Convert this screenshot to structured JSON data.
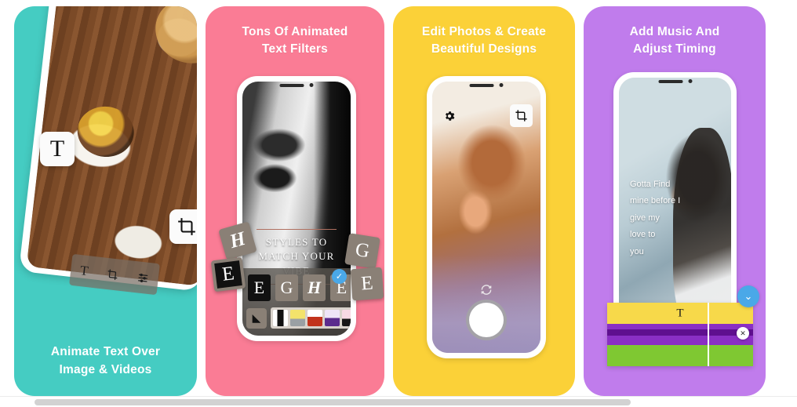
{
  "gallery": {
    "background": "#ffffff",
    "panels": [
      {
        "id": "animate-text",
        "accent": "#45ccc2",
        "title": "",
        "caption_line1": "Animate Text Over",
        "caption_line2": "Image & Videos",
        "photo_alt": "food-plates-on-wooden-table",
        "floating_icons": [
          {
            "name": "text-tool-icon",
            "glyph": "T"
          },
          {
            "name": "crop-tool-icon",
            "glyph": "crop"
          }
        ],
        "toolbar": {
          "items": [
            {
              "name": "text-tool",
              "glyph": "T"
            },
            {
              "name": "crop-tool",
              "glyph": "crop"
            },
            {
              "name": "adjust-sliders-tool",
              "glyph": "sliders"
            }
          ]
        }
      },
      {
        "id": "text-filters",
        "accent": "#fa7c95",
        "title_line1": "Tons Of Animated",
        "title_line2": "Text Filters",
        "caption_line1": "",
        "caption_line2": "",
        "screen_overlay": {
          "line1": "STYLES TO",
          "line2": "MATCH YOUR",
          "line3": "VIBE"
        },
        "floating_tiles": [
          {
            "name": "style-tile-h",
            "glyph": "H"
          },
          {
            "name": "style-tile-e-dark",
            "glyph": "E"
          },
          {
            "name": "style-tile-g",
            "glyph": "G"
          },
          {
            "name": "style-tile-e",
            "glyph": "E"
          }
        ],
        "style_row": [
          {
            "name": "style-option-e-dark",
            "glyph": "E",
            "selected": false
          },
          {
            "name": "style-option-g",
            "glyph": "G",
            "selected": false
          },
          {
            "name": "style-option-h",
            "glyph": "H",
            "selected": false
          },
          {
            "name": "style-option-e",
            "glyph": "E",
            "selected": true
          }
        ],
        "selected_badge": "✓",
        "ink_glyph": "◣",
        "filter_swatches": [
          "a",
          "b",
          "c",
          "d",
          "e"
        ]
      },
      {
        "id": "edit-photos",
        "accent": "#fbd138",
        "title_line1": "Edit Photos & Create",
        "title_line2": "Beautiful Designs",
        "caption_line1": "",
        "caption_line2": "",
        "controls": [
          {
            "name": "settings-gear-icon"
          },
          {
            "name": "crop-tool-icon"
          },
          {
            "name": "camera-flip-icon"
          },
          {
            "name": "shutter-button"
          }
        ]
      },
      {
        "id": "add-music",
        "accent": "#c07cec",
        "title_line1": "Add Music And",
        "title_line2": "Adjust Timing",
        "caption_line1": "",
        "caption_line2": "",
        "lyrics": [
          "Gotta Find",
          "mine before I",
          "give my",
          "love to",
          "you"
        ],
        "timeline": {
          "tracks": [
            {
              "name": "text-track",
              "color": "#f7d94a",
              "glyph": "T"
            },
            {
              "name": "music-track",
              "color": "#8a2fc4",
              "glyph": ""
            },
            {
              "name": "clip-track",
              "color": "#7fc832",
              "glyph": ""
            }
          ],
          "chevron_glyph": "⌄",
          "close_glyph": "✕"
        }
      }
    ]
  },
  "scrollbar": {
    "name": "horizontal-scrollbar"
  }
}
